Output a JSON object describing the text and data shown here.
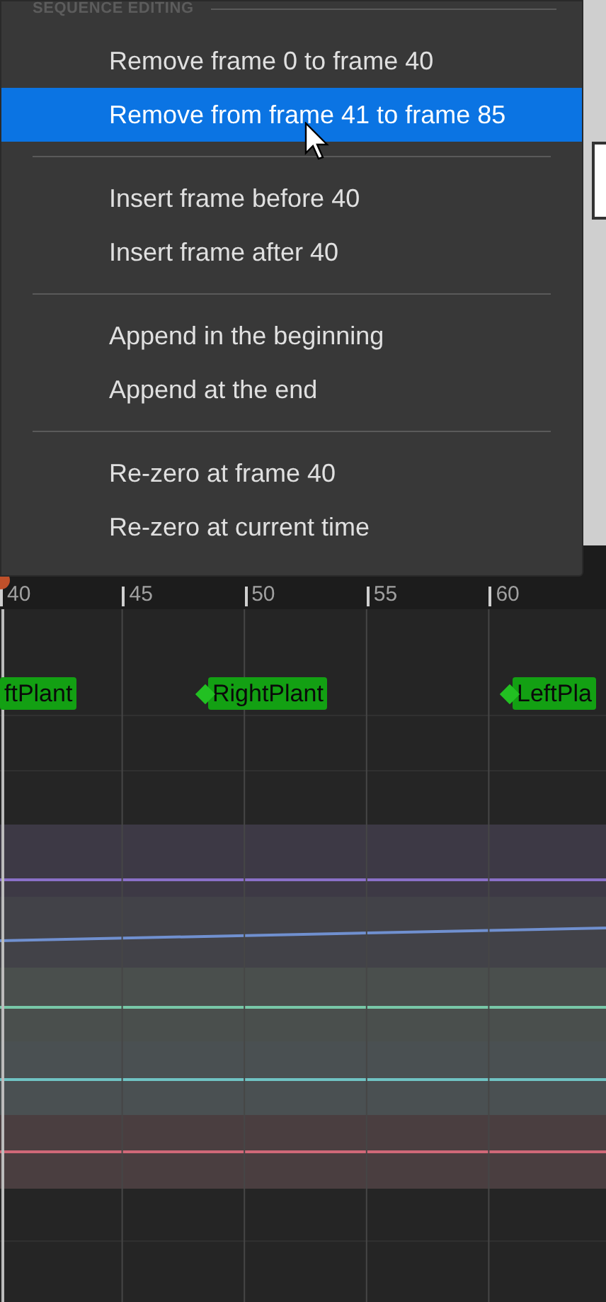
{
  "menu": {
    "header": "SEQUENCE EDITING",
    "items": [
      {
        "kind": "item",
        "label": "Remove frame 0 to frame 40",
        "selected": false
      },
      {
        "kind": "item",
        "label": "Remove from frame 41 to frame 85",
        "selected": true
      },
      {
        "kind": "separator"
      },
      {
        "kind": "item",
        "label": "Insert frame before 40",
        "selected": false
      },
      {
        "kind": "item",
        "label": "Insert frame after 40",
        "selected": false
      },
      {
        "kind": "separator"
      },
      {
        "kind": "item",
        "label": "Append in the beginning",
        "selected": false
      },
      {
        "kind": "item",
        "label": "Append at the end",
        "selected": false
      },
      {
        "kind": "separator"
      },
      {
        "kind": "item",
        "label": "Re-zero at frame 40",
        "selected": false
      },
      {
        "kind": "item",
        "label": "Re-zero at current time",
        "selected": false
      }
    ]
  },
  "timeline": {
    "ticks": [
      "40",
      "45",
      "50",
      "55",
      "60"
    ],
    "notifies": [
      {
        "label": "ftPlant",
        "diamond": false
      },
      {
        "label": "RightPlant",
        "diamond": true
      },
      {
        "label": "LeftPla",
        "diamond": true
      }
    ]
  }
}
